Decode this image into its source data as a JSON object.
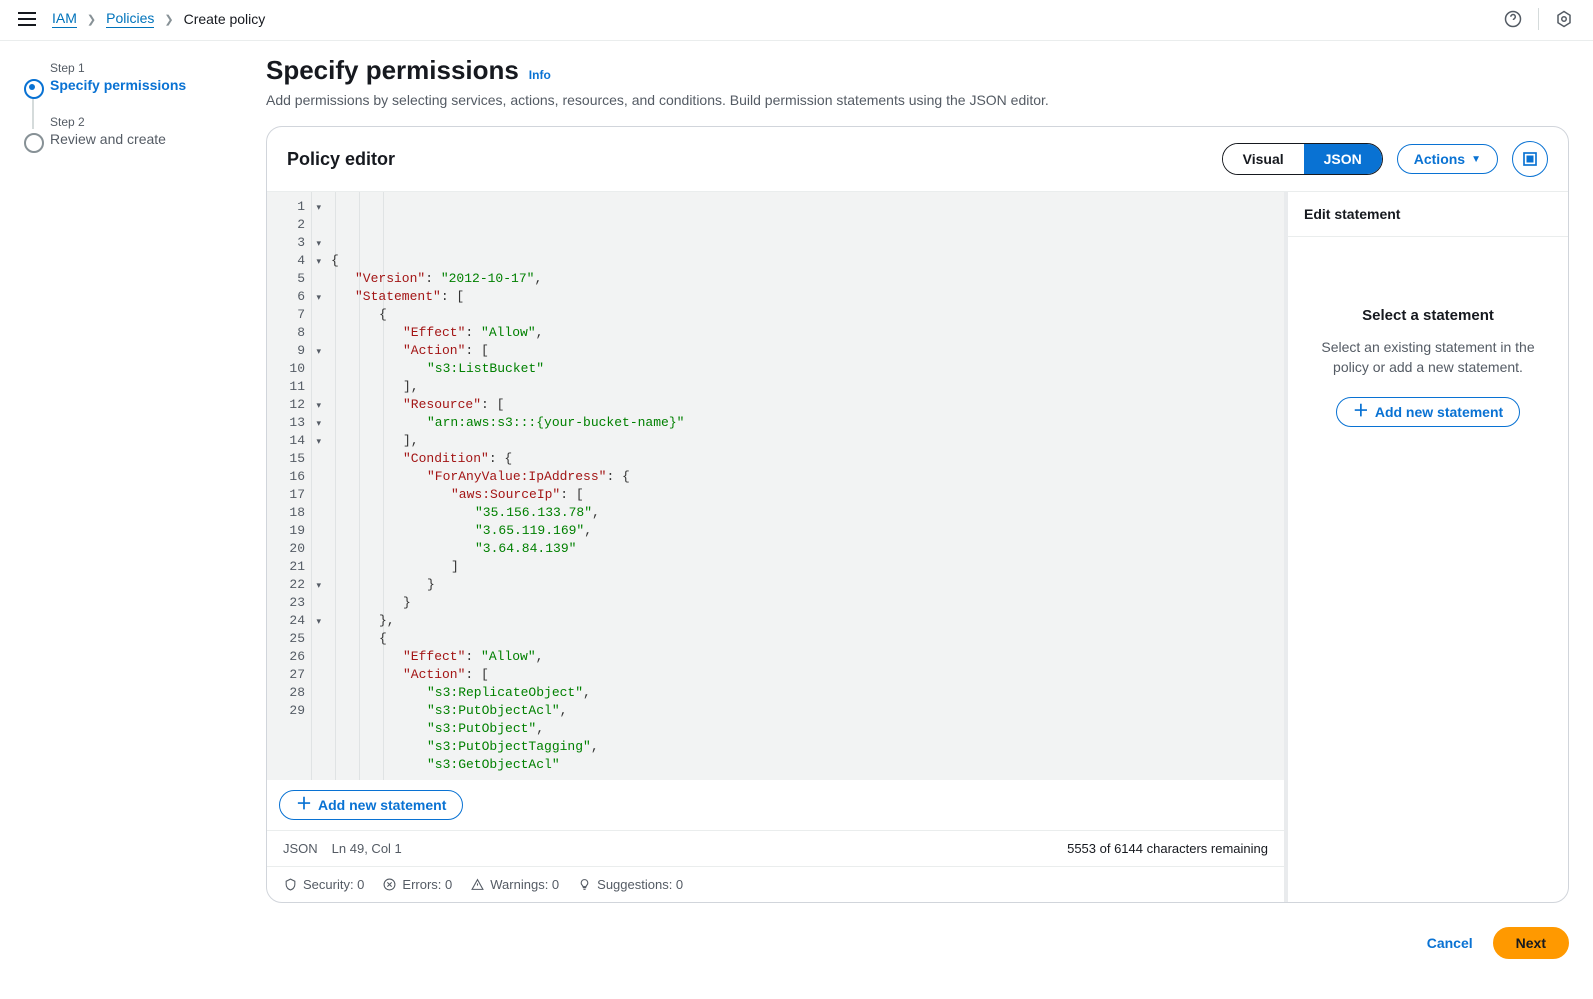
{
  "breadcrumbs": {
    "iam": "IAM",
    "policies": "Policies",
    "current": "Create policy"
  },
  "wizard": {
    "step1_num": "Step 1",
    "step1_title": "Specify permissions",
    "step2_num": "Step 2",
    "step2_title": "Review and create"
  },
  "header": {
    "title": "Specify permissions",
    "info": "Info",
    "desc": "Add permissions by selecting services, actions, resources, and conditions. Build permission statements using the JSON editor."
  },
  "panel": {
    "title": "Policy editor",
    "seg_visual": "Visual",
    "seg_json": "JSON",
    "actions": "Actions"
  },
  "code": {
    "lines": [
      {
        "n": "1",
        "fold": true,
        "indent": 0,
        "tokens": [
          {
            "t": "p",
            "v": "{"
          }
        ]
      },
      {
        "n": "2",
        "fold": false,
        "indent": 1,
        "tokens": [
          {
            "t": "k",
            "v": "\"Version\""
          },
          {
            "t": "p",
            "v": ": "
          },
          {
            "t": "s",
            "v": "\"2012-10-17\""
          },
          {
            "t": "p",
            "v": ","
          }
        ]
      },
      {
        "n": "3",
        "fold": true,
        "indent": 1,
        "tokens": [
          {
            "t": "k",
            "v": "\"Statement\""
          },
          {
            "t": "p",
            "v": ": ["
          }
        ]
      },
      {
        "n": "4",
        "fold": true,
        "indent": 2,
        "tokens": [
          {
            "t": "p",
            "v": "{"
          }
        ]
      },
      {
        "n": "5",
        "fold": false,
        "indent": 3,
        "tokens": [
          {
            "t": "k",
            "v": "\"Effect\""
          },
          {
            "t": "p",
            "v": ": "
          },
          {
            "t": "s",
            "v": "\"Allow\""
          },
          {
            "t": "p",
            "v": ","
          }
        ]
      },
      {
        "n": "6",
        "fold": true,
        "indent": 3,
        "tokens": [
          {
            "t": "k",
            "v": "\"Action\""
          },
          {
            "t": "p",
            "v": ": ["
          }
        ]
      },
      {
        "n": "7",
        "fold": false,
        "indent": 4,
        "tokens": [
          {
            "t": "s",
            "v": "\"s3:ListBucket\""
          }
        ]
      },
      {
        "n": "8",
        "fold": false,
        "indent": 3,
        "tokens": [
          {
            "t": "p",
            "v": "],"
          }
        ]
      },
      {
        "n": "9",
        "fold": true,
        "indent": 3,
        "tokens": [
          {
            "t": "k",
            "v": "\"Resource\""
          },
          {
            "t": "p",
            "v": ": ["
          }
        ]
      },
      {
        "n": "10",
        "fold": false,
        "indent": 4,
        "tokens": [
          {
            "t": "s",
            "v": "\"arn:aws:s3:::{your-bucket-name}\""
          }
        ]
      },
      {
        "n": "11",
        "fold": false,
        "indent": 3,
        "tokens": [
          {
            "t": "p",
            "v": "],"
          }
        ]
      },
      {
        "n": "12",
        "fold": true,
        "indent": 3,
        "tokens": [
          {
            "t": "k",
            "v": "\"Condition\""
          },
          {
            "t": "p",
            "v": ": {"
          }
        ]
      },
      {
        "n": "13",
        "fold": true,
        "indent": 4,
        "tokens": [
          {
            "t": "k",
            "v": "\"ForAnyValue:IpAddress\""
          },
          {
            "t": "p",
            "v": ": {"
          }
        ]
      },
      {
        "n": "14",
        "fold": true,
        "indent": 5,
        "tokens": [
          {
            "t": "k",
            "v": "\"aws:SourceIp\""
          },
          {
            "t": "p",
            "v": ": ["
          }
        ]
      },
      {
        "n": "15",
        "fold": false,
        "indent": 6,
        "tokens": [
          {
            "t": "s",
            "v": "\"35.156.133.78\""
          },
          {
            "t": "p",
            "v": ","
          }
        ]
      },
      {
        "n": "16",
        "fold": false,
        "indent": 6,
        "tokens": [
          {
            "t": "s",
            "v": "\"3.65.119.169\""
          },
          {
            "t": "p",
            "v": ","
          }
        ]
      },
      {
        "n": "17",
        "fold": false,
        "indent": 6,
        "tokens": [
          {
            "t": "s",
            "v": "\"3.64.84.139\""
          }
        ]
      },
      {
        "n": "18",
        "fold": false,
        "indent": 5,
        "tokens": [
          {
            "t": "p",
            "v": "]"
          }
        ]
      },
      {
        "n": "19",
        "fold": false,
        "indent": 4,
        "tokens": [
          {
            "t": "p",
            "v": "}"
          }
        ]
      },
      {
        "n": "20",
        "fold": false,
        "indent": 3,
        "tokens": [
          {
            "t": "p",
            "v": "}"
          }
        ]
      },
      {
        "n": "21",
        "fold": false,
        "indent": 2,
        "tokens": [
          {
            "t": "p",
            "v": "},"
          }
        ]
      },
      {
        "n": "22",
        "fold": true,
        "indent": 2,
        "tokens": [
          {
            "t": "p",
            "v": "{"
          }
        ]
      },
      {
        "n": "23",
        "fold": false,
        "indent": 3,
        "tokens": [
          {
            "t": "k",
            "v": "\"Effect\""
          },
          {
            "t": "p",
            "v": ": "
          },
          {
            "t": "s",
            "v": "\"Allow\""
          },
          {
            "t": "p",
            "v": ","
          }
        ]
      },
      {
        "n": "24",
        "fold": true,
        "indent": 3,
        "tokens": [
          {
            "t": "k",
            "v": "\"Action\""
          },
          {
            "t": "p",
            "v": ": ["
          }
        ]
      },
      {
        "n": "25",
        "fold": false,
        "indent": 4,
        "tokens": [
          {
            "t": "s",
            "v": "\"s3:ReplicateObject\""
          },
          {
            "t": "p",
            "v": ","
          }
        ]
      },
      {
        "n": "26",
        "fold": false,
        "indent": 4,
        "tokens": [
          {
            "t": "s",
            "v": "\"s3:PutObjectAcl\""
          },
          {
            "t": "p",
            "v": ","
          }
        ]
      },
      {
        "n": "27",
        "fold": false,
        "indent": 4,
        "tokens": [
          {
            "t": "s",
            "v": "\"s3:PutObject\""
          },
          {
            "t": "p",
            "v": ","
          }
        ]
      },
      {
        "n": "28",
        "fold": false,
        "indent": 4,
        "tokens": [
          {
            "t": "s",
            "v": "\"s3:PutObjectTagging\""
          },
          {
            "t": "p",
            "v": ","
          }
        ]
      },
      {
        "n": "29",
        "fold": false,
        "indent": 4,
        "tokens": [
          {
            "t": "s",
            "v": "\"s3:GetObjectAcl\""
          }
        ]
      }
    ]
  },
  "add_stmt": "Add new statement",
  "status": {
    "mode": "JSON",
    "cursor": "Ln 49, Col 1",
    "remaining": "5553 of 6144 characters remaining"
  },
  "messages": {
    "security": "Security: 0",
    "errors": "Errors: 0",
    "warnings": "Warnings: 0",
    "suggestions": "Suggestions: 0"
  },
  "inspector": {
    "head": "Edit statement",
    "title": "Select a statement",
    "desc": "Select an existing statement in the policy or add a new statement.",
    "add": "Add new statement"
  },
  "footer": {
    "cancel": "Cancel",
    "next": "Next"
  }
}
